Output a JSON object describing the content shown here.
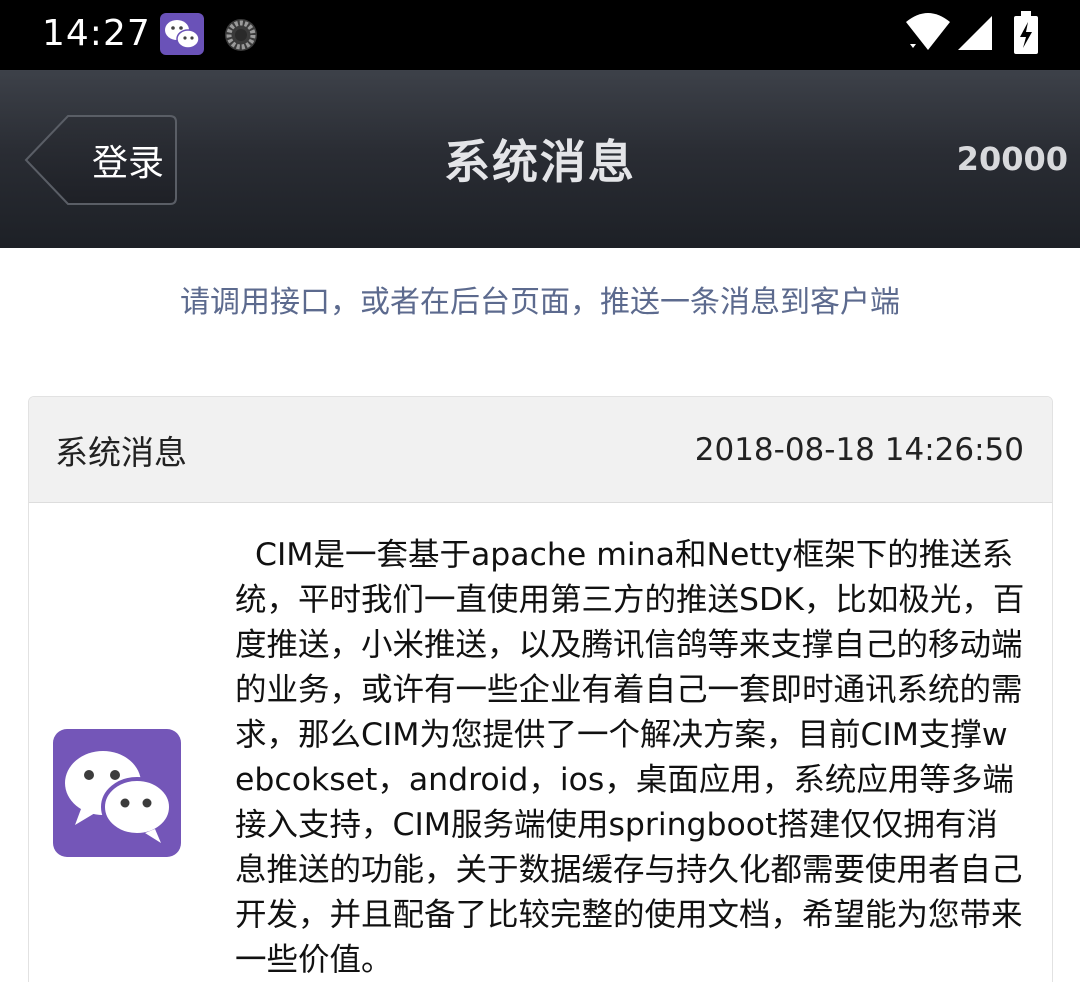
{
  "status_bar": {
    "time": "14:27"
  },
  "title_bar": {
    "back_label": "登录",
    "title": "系统消息",
    "count": "20000"
  },
  "hint": "请调用接口，或者在后台页面，推送一条消息到客户端",
  "message": {
    "title": "系统消息",
    "time": "2018-08-18 14:26:50",
    "body": "CIM是一套基于apache mina和Netty框架下的推送系统，平时我们一直使用第三方的推送SDK，比如极光，百度推送，小米推送，以及腾讯信鸽等来支撑自己的移动端的业务，或许有一些企业有着自己一套即时通讯系统的需求，那么CIM为您提供了一个解决方案，目前CIM支撑webcokset，android，ios，桌面应用，系统应用等多端接入支持，CIM服务端使用springboot搭建仅仅拥有消息推送的功能，关于数据缓存与持久化都需要使用者自己开发，并且配备了比较完整的使用文档，希望能为您带来一些价值。"
  },
  "colors": {
    "title_bar_top": "#3d4149",
    "title_bar_bottom": "#1d2026",
    "hint_text": "#5c6a8e",
    "avatar_bg": "#7456b8"
  },
  "icons": {
    "status_app": "wechat-icon",
    "status_spinner": "loading-spinner-icon",
    "wifi": "wifi-icon",
    "signal": "cell-signal-icon",
    "battery": "battery-charging-icon",
    "back": "back-arrow-icon",
    "avatar": "wechat-icon"
  }
}
